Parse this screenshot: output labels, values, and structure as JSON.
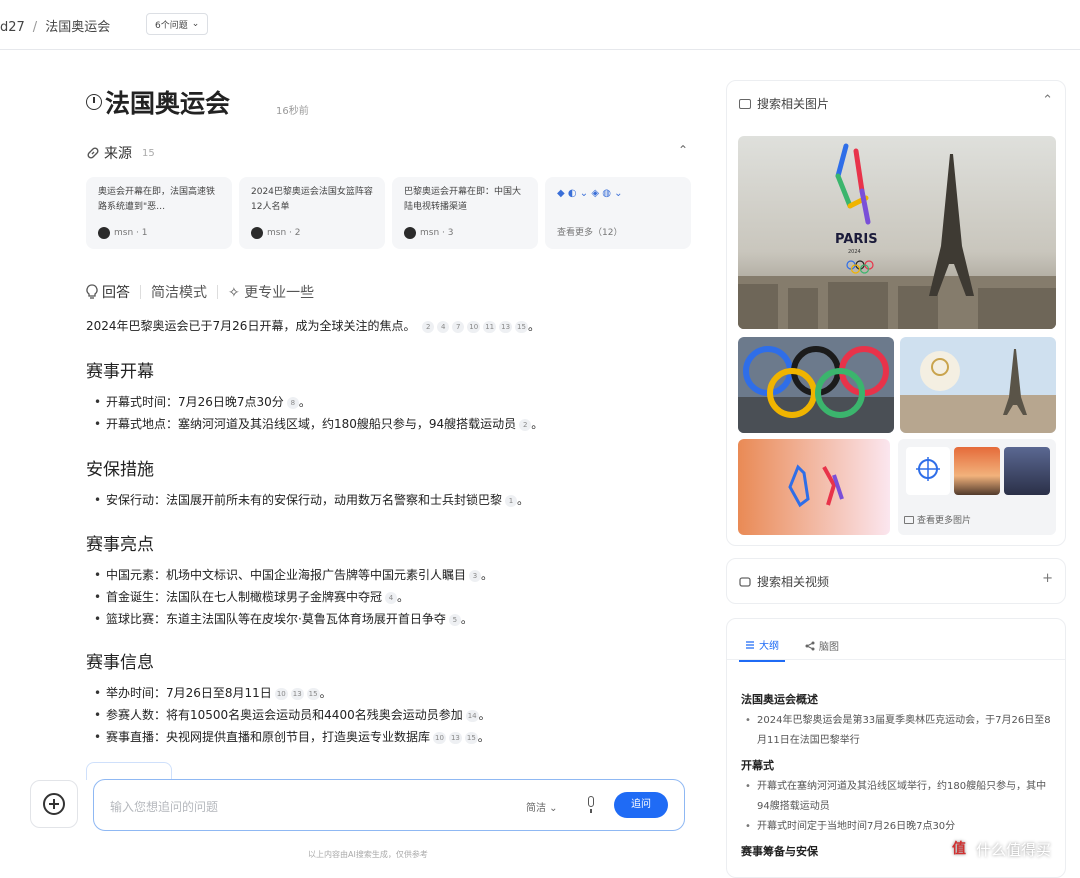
{
  "topbar": {
    "crumb_prefix": "d27",
    "crumb_sep": "/",
    "crumb_title": "法国奥运会",
    "questions_btn": "6个问题",
    "questions_chevron": "⌄"
  },
  "question": {
    "title": "法国奥运会",
    "time": "16秒前"
  },
  "sources": {
    "label": "来源",
    "count": "15",
    "toggle": "⌃",
    "cards": [
      {
        "text": "奥运会开幕在即，法国高速铁路系统遭到\"恶…",
        "meta": "msn · 1"
      },
      {
        "text": "2024巴黎奥运会法国女篮阵容12人名单",
        "meta": "msn · 2"
      },
      {
        "text": "巴黎奥运会开幕在即：中国大陆电视转播渠道",
        "meta": "msn · 3"
      }
    ],
    "more_icons": "◆ ◐ ⌄ ◈ ◍ ⌄",
    "view_all": "查看更多（12）"
  },
  "answer": {
    "label": "回答",
    "mode_simple": "简洁模式",
    "mode_pro": "✧ 更专业一些",
    "summary": "2024年巴黎奥运会已于7月26日开幕，成为全球关注的焦点。",
    "summary_cites": [
      "2",
      "4",
      "7",
      "10",
      "11",
      "13",
      "15"
    ],
    "sections": [
      {
        "title": "赛事开幕",
        "items": [
          {
            "text": "开幕式时间：7月26日晚7点30分",
            "cites": [
              "8"
            ]
          },
          {
            "text": "开幕式地点：塞纳河河道及其沿线区域，约180艘船只参与，94艘搭载运动员",
            "cites": [
              "2"
            ]
          }
        ]
      },
      {
        "title": "安保措施",
        "items": [
          {
            "text": "安保行动：法国展开前所未有的安保行动，动用数万名警察和士兵封锁巴黎",
            "cites": [
              "1"
            ]
          }
        ]
      },
      {
        "title": "赛事亮点",
        "items": [
          {
            "text": "中国元素：机场中文标识、中国企业海报广告牌等中国元素引人瞩目",
            "cites": [
              "3"
            ]
          },
          {
            "text": "首金诞生：法国队在七人制橄榄球男子金牌赛中夺冠",
            "cites": [
              "4"
            ]
          },
          {
            "text": "篮球比赛：东道主法国队等在皮埃尔·莫鲁瓦体育场展开首日争夺",
            "cites": [
              "5"
            ]
          }
        ]
      },
      {
        "title": "赛事信息",
        "items": [
          {
            "text": "举办时间：7月26日至8月11日",
            "cites": [
              "10",
              "13",
              "15"
            ]
          },
          {
            "text": "参赛人数：将有10500名奥运会运动员和4400名残奥会运动员参加",
            "cites": [
              "14"
            ]
          },
          {
            "text": "赛事直播：央视网提供直播和原创节目，打造奥运专业数据库",
            "cites": [
              "10",
              "13",
              "15"
            ]
          }
        ]
      }
    ]
  },
  "composer": {
    "placeholder": "输入您想追问的问题",
    "mode": "简洁 ⌄",
    "send": "追问",
    "disclaimer": "以上内容由AI搜索生成，仅供参考"
  },
  "images_panel": {
    "title": "搜索相关图片",
    "toggle": "⌃",
    "paris_text": "PARIS",
    "paris_year": "2024",
    "more_label": "查看更多图片"
  },
  "videos_panel": {
    "title": "搜索相关视频",
    "toggle": "+"
  },
  "outline_panel": {
    "tab_outline": "大纲",
    "tab_mindmap": "脑图",
    "sections": [
      {
        "title": "法国奥运会概述",
        "items": [
          "2024年巴黎奥运会是第33届夏季奥林匹克运动会，于7月26日至8月11日在法国巴黎举行"
        ]
      },
      {
        "title": "开幕式",
        "items": [
          "开幕式在塞纳河河道及其沿线区域举行，约180艘船只参与，其中94艘搭载运动员",
          "开幕式时间定于当地时间7月26日晚7点30分"
        ]
      },
      {
        "title": "赛事筹备与安保",
        "items": []
      }
    ]
  },
  "watermark": {
    "text": "什么值得买",
    "logo": "值"
  },
  "colors": {
    "accent": "#1f6bf5",
    "border": "#e6e8ec",
    "card_bg": "#f5f6f8"
  }
}
